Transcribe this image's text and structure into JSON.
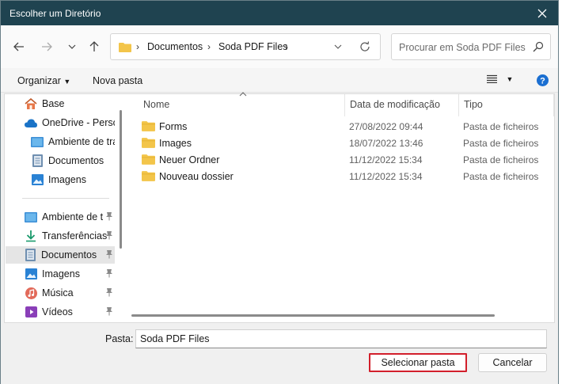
{
  "window": {
    "title": "Escolher um Diretório"
  },
  "nav": {
    "breadcrumb": [
      "Documentos",
      "Soda PDF Files"
    ],
    "search_placeholder": "Procurar em Soda PDF Files"
  },
  "toolbar": {
    "organize_label": "Organizar",
    "new_folder_label": "Nova pasta"
  },
  "sidebar": {
    "items": [
      {
        "label": "Base",
        "icon": "home-icon"
      },
      {
        "label": "OneDrive - Perso",
        "icon": "cloud-icon"
      },
      {
        "label": "Ambiente de tra",
        "icon": "desktop-icon"
      },
      {
        "label": "Documentos",
        "icon": "documents-icon"
      },
      {
        "label": "Imagens",
        "icon": "pictures-icon"
      },
      {
        "label": "Ambiente de t",
        "icon": "desktop-icon",
        "pinned": true
      },
      {
        "label": "Transferências",
        "icon": "download-icon",
        "pinned": true
      },
      {
        "label": "Documentos",
        "icon": "documents-icon",
        "pinned": true,
        "selected": true
      },
      {
        "label": "Imagens",
        "icon": "pictures-icon",
        "pinned": true
      },
      {
        "label": "Música",
        "icon": "music-icon",
        "pinned": true
      },
      {
        "label": "Vídeos",
        "icon": "video-icon",
        "pinned": true
      }
    ]
  },
  "files": {
    "columns": [
      "Nome",
      "Data de modificação",
      "Tipo"
    ],
    "rows": [
      {
        "name": "Forms",
        "date": "27/08/2022 09:44",
        "type": "Pasta de ficheiros"
      },
      {
        "name": "Images",
        "date": "18/07/2022 13:46",
        "type": "Pasta de ficheiros"
      },
      {
        "name": "Neuer Ordner",
        "date": "11/12/2022 15:34",
        "type": "Pasta de ficheiros"
      },
      {
        "name": "Nouveau dossier",
        "date": "11/12/2022 15:34",
        "type": "Pasta de ficheiros"
      }
    ]
  },
  "footer": {
    "folder_label": "Pasta:",
    "folder_value": "Soda PDF Files",
    "select_button": "Selecionar pasta",
    "cancel_button": "Cancelar"
  },
  "colors": {
    "titlebar": "#1f4350",
    "folder": "#f3c54a",
    "highlight_border": "#d21f2b",
    "help_blue": "#1b6fd1"
  }
}
